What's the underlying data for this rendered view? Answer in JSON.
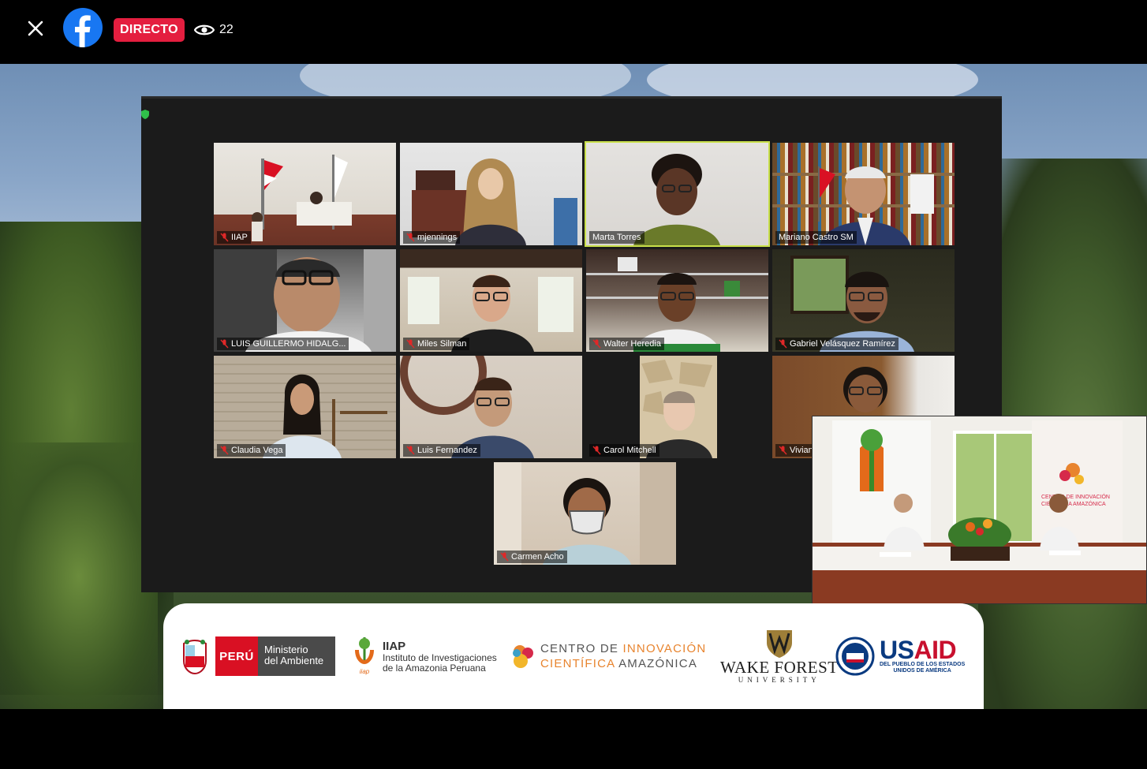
{
  "header": {
    "close_icon": "close-icon",
    "logo_icon": "facebook-logo-icon",
    "live_label": "DIRECTO",
    "viewers_icon": "eye-icon",
    "viewer_count": "22",
    "live_color": "#e41e3f",
    "brand_color": "#1877f2"
  },
  "meeting": {
    "active_speaker_color": "#c9e04a",
    "participants": [
      {
        "name": "IIAP"
      },
      {
        "name": "mjennings"
      },
      {
        "name": "Marta Torres"
      },
      {
        "name": "Mariano Castro SM"
      },
      {
        "name": "LUIS GUILLERMO HIDALG..."
      },
      {
        "name": "Miles Silman"
      },
      {
        "name": "Walter Heredia"
      },
      {
        "name": "Gabriel Velásquez Ramírez"
      },
      {
        "name": "Claudia Vega"
      },
      {
        "name": "Luis Fernandez"
      },
      {
        "name": "Carol Mitchell"
      },
      {
        "name": "Vivian"
      },
      {
        "name": "Carmen Acho"
      }
    ],
    "pip_banner_right": [
      "CENTRO DE INNOVACIÓN",
      "CIENTÍFICA AMAZÓNICA"
    ]
  },
  "sponsors": {
    "peru_country": "PERÚ",
    "peru_ministry_1": "Ministerio",
    "peru_ministry_2": "del Ambiente",
    "iiap_title": "IIAP",
    "iiap_sub_1": "Instituto de Investigaciones",
    "iiap_sub_2": "de la Amazonia Peruana",
    "iiap_mark": "iiap",
    "cia_line1_a": "CENTRO DE ",
    "cia_line1_b": "INNOVACIÓN",
    "cia_line2_a": "CIENTÍFICA ",
    "cia_line2_b": "AMAZÓNICA",
    "wf_name": "WAKE FOREST",
    "wf_sub": "UNIVERSITY",
    "usaid_us": "US",
    "usaid_aid": "AID",
    "usaid_sub_1": "DEL PUEBLO DE LOS ESTADOS",
    "usaid_sub_2": "UNIDOS DE AMÉRICA"
  }
}
